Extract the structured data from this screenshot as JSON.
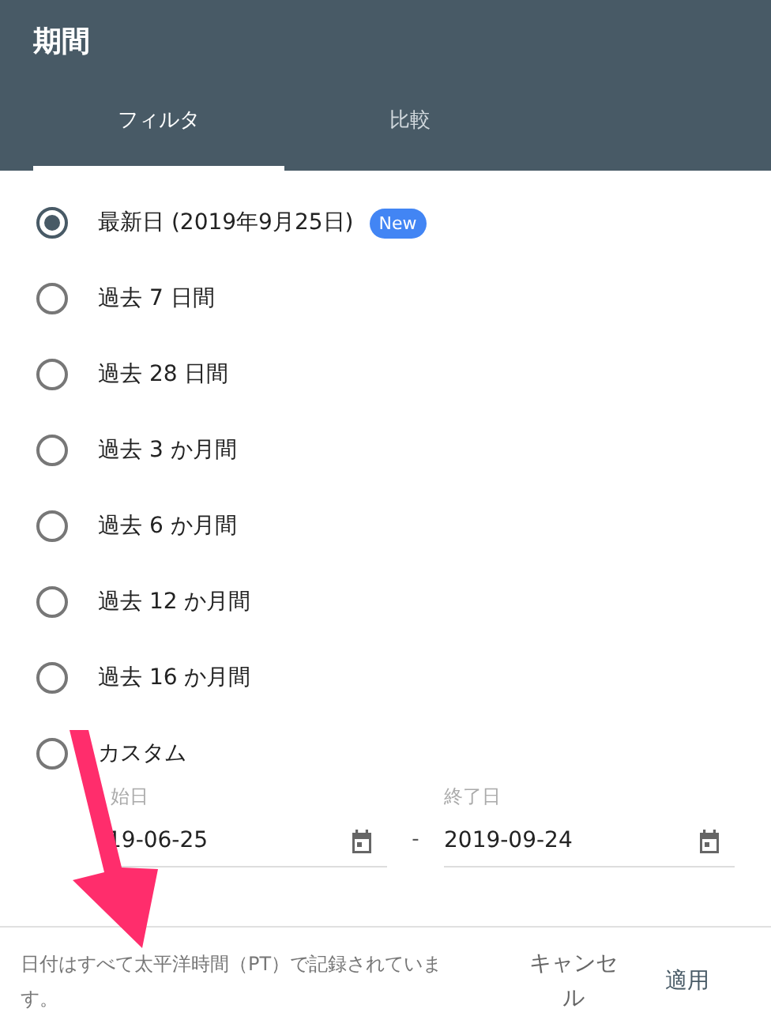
{
  "title": "期間",
  "tabs": [
    {
      "label": "フィルタ",
      "selected": true
    },
    {
      "label": "比較",
      "selected": false
    }
  ],
  "options": [
    {
      "label": "最新日 (2019年9月25日)",
      "selected": true,
      "badge": "New"
    },
    {
      "label": "過去 7 日間",
      "selected": false
    },
    {
      "label": "過去 28 日間",
      "selected": false
    },
    {
      "label": "過去 3 か月間",
      "selected": false
    },
    {
      "label": "過去 6 か月間",
      "selected": false
    },
    {
      "label": "過去 12 か月間",
      "selected": false
    },
    {
      "label": "過去 16 か月間",
      "selected": false
    },
    {
      "label": "カスタム",
      "selected": false
    }
  ],
  "custom_range": {
    "start": {
      "label": "始日",
      "value": "19-06-25"
    },
    "separator": "-",
    "end": {
      "label": "終了日",
      "value": "2019-09-24"
    }
  },
  "footer": {
    "note": "日付はすべて太平洋時間（PT）で記録されています。",
    "buttons": [
      "キャンセル",
      "適用"
    ]
  }
}
